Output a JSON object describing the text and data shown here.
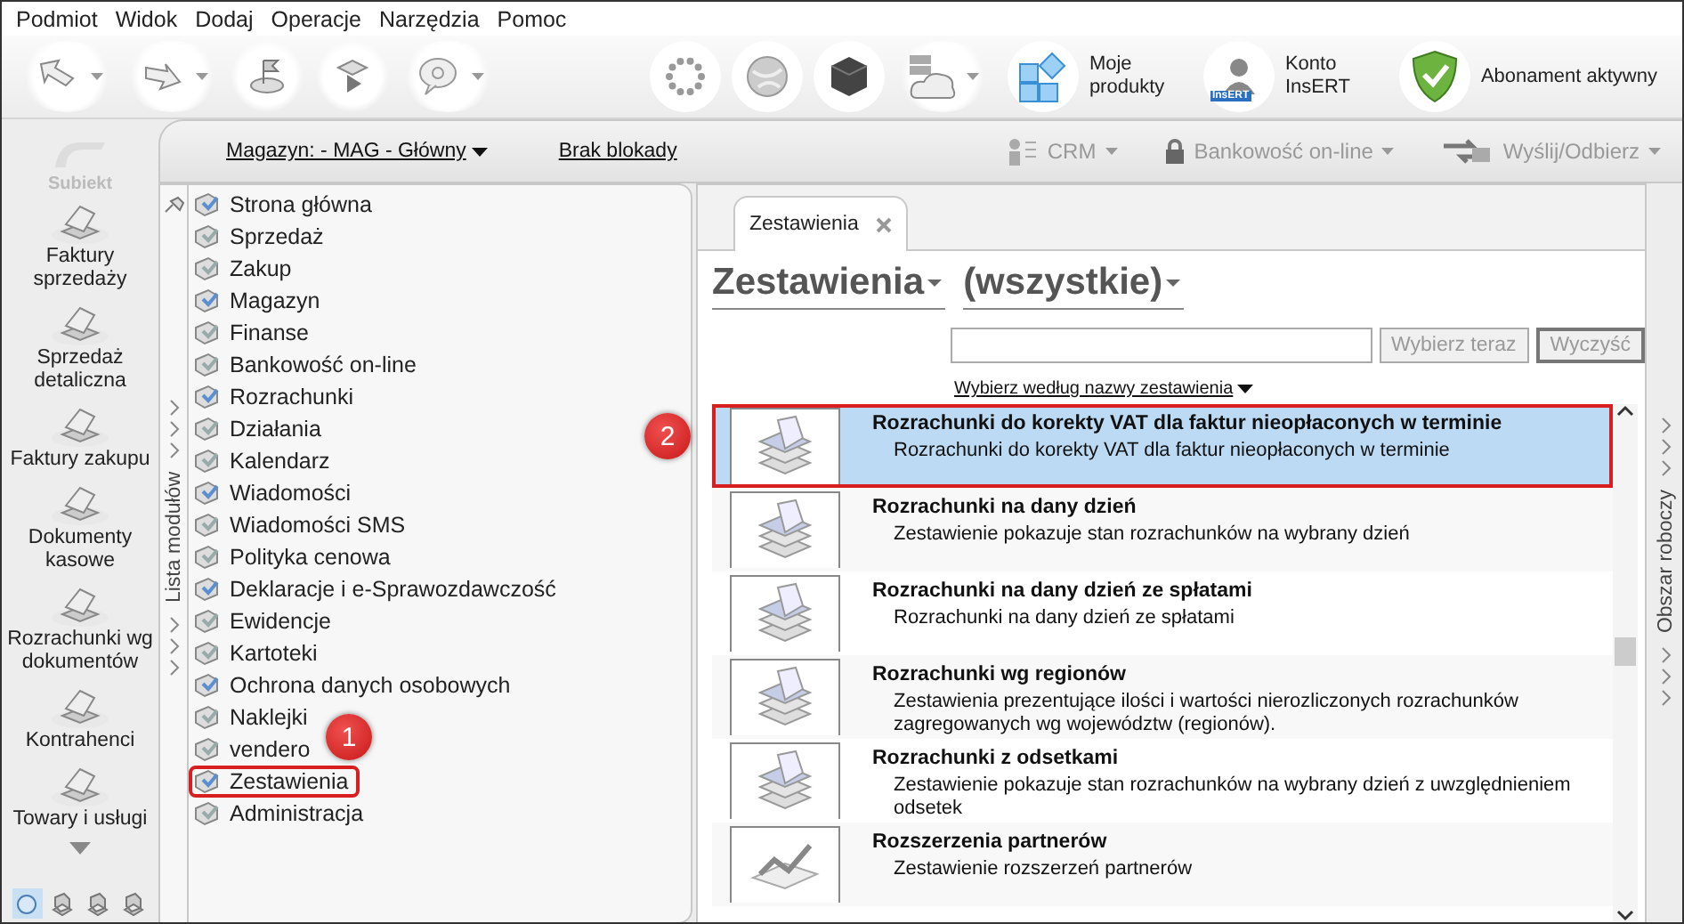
{
  "menu": [
    "Podmiot",
    "Widok",
    "Dodaj",
    "Operacje",
    "Narzędzia",
    "Pomoc"
  ],
  "toolbar_links": [
    {
      "label": "Moje produkty",
      "kind": "tiles"
    },
    {
      "label": "Konto InsERT",
      "kind": "account",
      "badge": "InsERT"
    },
    {
      "label": "Abonament aktywny",
      "kind": "shield"
    }
  ],
  "logo": {
    "name": "Subiekt"
  },
  "nav": [
    {
      "label": "Faktury sprzedaży"
    },
    {
      "label": "Sprzedaż detaliczna"
    },
    {
      "label": "Faktury zakupu"
    },
    {
      "label": "Dokumenty kasowe"
    },
    {
      "label": "Rozrachunki wg dokumentów"
    },
    {
      "label": "Kontrahenci"
    },
    {
      "label": "Towary i usługi"
    }
  ],
  "nav_views": [
    {
      "selected": true
    },
    {
      "selected": false
    },
    {
      "selected": false
    },
    {
      "selected": false
    }
  ],
  "header": {
    "warehouse": "Magazyn: - MAG - Główny",
    "lock": "Brak blokady",
    "actions": [
      {
        "label": "CRM",
        "kind": "crm"
      },
      {
        "label": "Bankowość on-line",
        "kind": "bank"
      },
      {
        "label": "Wyślij/Odbierz",
        "kind": "sync"
      }
    ]
  },
  "modules": {
    "title": "Lista modułów",
    "items": [
      {
        "label": "Strona główna",
        "highlighted": false
      },
      {
        "label": "Sprzedaż",
        "highlighted": false
      },
      {
        "label": "Zakup",
        "highlighted": false
      },
      {
        "label": "Magazyn",
        "highlighted": false
      },
      {
        "label": "Finanse",
        "highlighted": false
      },
      {
        "label": "Bankowość on-line",
        "highlighted": false
      },
      {
        "label": "Rozrachunki",
        "highlighted": false
      },
      {
        "label": "Działania",
        "highlighted": false
      },
      {
        "label": "Kalendarz",
        "highlighted": false
      },
      {
        "label": "Wiadomości",
        "highlighted": false
      },
      {
        "label": "Wiadomości SMS",
        "highlighted": false
      },
      {
        "label": "Polityka cenowa",
        "highlighted": false
      },
      {
        "label": "Deklaracje i e-Sprawozdawczość",
        "highlighted": false
      },
      {
        "label": "Ewidencje",
        "highlighted": false
      },
      {
        "label": "Kartoteki",
        "highlighted": false
      },
      {
        "label": "Ochrona danych osobowych",
        "highlighted": false
      },
      {
        "label": "Naklejki",
        "highlighted": false
      },
      {
        "label": "vendero",
        "highlighted": false
      },
      {
        "label": "Zestawienia",
        "highlighted": true
      },
      {
        "label": "Administracja",
        "highlighted": false
      }
    ]
  },
  "workspace": {
    "title": "Obszar roboczy"
  },
  "tabs": [
    {
      "label": "Zestawienia",
      "selected": true
    }
  ],
  "heading": {
    "category": "Zestawienia",
    "filter": "(wszystkie)"
  },
  "search": {
    "buttons": [
      {
        "label": "Wybierz teraz",
        "disabled": true
      },
      {
        "label": "Wyczyść",
        "disabled": true
      }
    ],
    "mode": "Wybierz według nazwy zestawienia"
  },
  "reports": [
    {
      "title": "Rozrachunki do korekty VAT dla faktur nieopłaconych w terminie",
      "description": "Rozrachunki do korekty VAT dla faktur nieopłaconych w terminie",
      "kind": "money",
      "selected": true,
      "highlighted": true
    },
    {
      "title": "Rozrachunki na dany dzień",
      "description": "Zestawienie pokazuje stan rozrachunków na wybrany dzień",
      "kind": "money",
      "selected": false,
      "highlighted": false
    },
    {
      "title": "Rozrachunki na dany dzień ze spłatami",
      "description": "Rozrachunki na dany dzień ze spłatami",
      "kind": "money",
      "selected": false,
      "highlighted": false
    },
    {
      "title": "Rozrachunki wg regionów",
      "description": "Zestawienia prezentujące ilości i wartości nierozliczonych rozrachunków zagregowanych wg województw (regionów).",
      "kind": "money",
      "selected": false,
      "highlighted": false
    },
    {
      "title": "Rozrachunki z odsetkami",
      "description": "Zestawienie pokazuje stan rozrachunków na wybrany dzień z uwzględnieniem odsetek",
      "kind": "money",
      "selected": false,
      "highlighted": false
    },
    {
      "title": "Rozszerzenia partnerów",
      "description": "Zestawienie rozszerzeń partnerów",
      "kind": "chart",
      "selected": false,
      "highlighted": false
    }
  ],
  "annotations": [
    {
      "label": "1"
    },
    {
      "label": "2"
    }
  ]
}
